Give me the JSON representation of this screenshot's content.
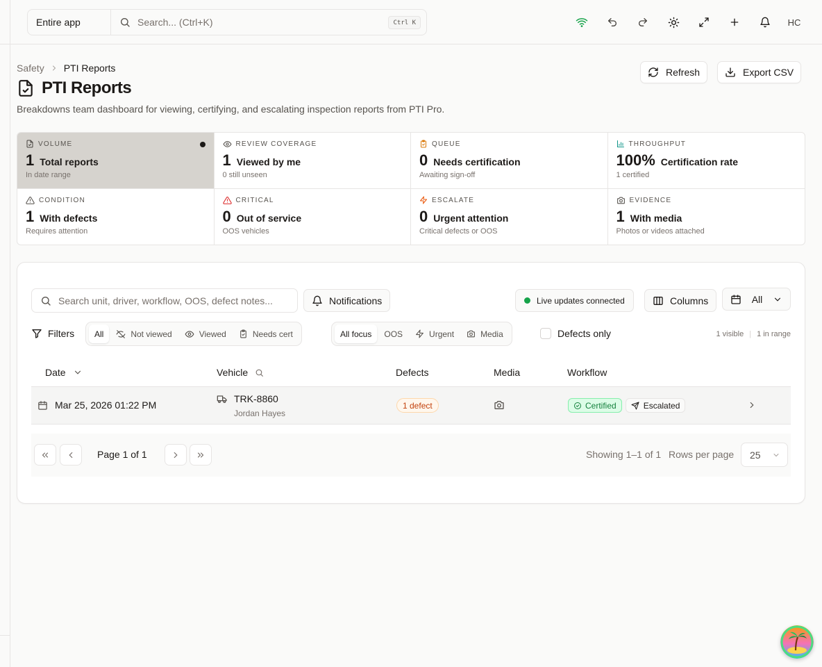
{
  "topbar": {
    "scope": "Entire app",
    "search_placeholder": "Search... (Ctrl+K)",
    "shortcut": "Ctrl K",
    "avatar_initials": "HC",
    "icons": [
      "wifi-icon",
      "undo-icon",
      "redo-icon",
      "sun-icon",
      "expand-icon",
      "plus-icon",
      "bell-icon"
    ]
  },
  "breadcrumb": {
    "parent": "Safety",
    "current": "PTI Reports"
  },
  "page": {
    "title": "PTI Reports",
    "subtitle": "Breakdowns team dashboard for viewing, certifying, and escalating inspection reports from PTI Pro.",
    "refresh_label": "Refresh",
    "export_label": "Export CSV"
  },
  "stats": [
    {
      "heading": "VOLUME",
      "value": "1",
      "label": "Total reports",
      "sub": "In date range",
      "icon": "file-check-icon"
    },
    {
      "heading": "REVIEW COVERAGE",
      "value": "1",
      "label": "Viewed by me",
      "sub": "0 still unseen",
      "icon": "eye-icon"
    },
    {
      "heading": "QUEUE",
      "value": "0",
      "label": "Needs certification",
      "sub": "Awaiting sign-off",
      "icon": "clipboard-check-icon"
    },
    {
      "heading": "THROUGHPUT",
      "value": "100%",
      "label": "Certification rate",
      "sub": "1 certified",
      "icon": "bar-chart-icon"
    },
    {
      "heading": "CONDITION",
      "value": "1",
      "label": "With defects",
      "sub": "Requires attention",
      "icon": "warning-icon"
    },
    {
      "heading": "CRITICAL",
      "value": "0",
      "label": "Out of service",
      "sub": "OOS vehicles",
      "icon": "alert-triangle-icon"
    },
    {
      "heading": "ESCALATE",
      "value": "0",
      "label": "Urgent attention",
      "sub": "Critical defects or OOS",
      "icon": "zap-icon"
    },
    {
      "heading": "EVIDENCE",
      "value": "1",
      "label": "With media",
      "sub": "Photos or videos attached",
      "icon": "camera-icon"
    }
  ],
  "colors": {
    "accent_green": "#16a34a",
    "orange": "#ea580c",
    "red": "#dc2626",
    "amber": "#d97706",
    "teal": "#0d9488"
  },
  "toolbar": {
    "search_placeholder": "Search unit, driver, workflow, OOS, defect notes...",
    "notifications_label": "Notifications",
    "live_label": "Live updates connected",
    "columns_label": "Columns",
    "date_range_label": "All"
  },
  "filters": {
    "label": "Filters",
    "view_options": [
      "All",
      "Not viewed",
      "Viewed",
      "Needs cert"
    ],
    "focus_options": [
      "All focus",
      "OOS",
      "Urgent",
      "Media"
    ],
    "defects_only_label": "Defects only",
    "visible_count": "1 visible",
    "range_count": "1 in range"
  },
  "table": {
    "columns": [
      "Date",
      "Vehicle",
      "Defects",
      "Media",
      "Workflow"
    ],
    "rows": [
      {
        "date": "Mar 25, 2026 01:22 PM",
        "unit": "TRK-8860",
        "driver": "Jordan Hayes",
        "defects": "1 defect",
        "workflow_status": "Certified",
        "workflow_flag": "Escalated"
      }
    ]
  },
  "pagination": {
    "page_label": "Page 1 of 1",
    "showing": "Showing 1–1 of 1",
    "rows_per_page_label": "Rows per page",
    "rows_per_page": "25"
  }
}
